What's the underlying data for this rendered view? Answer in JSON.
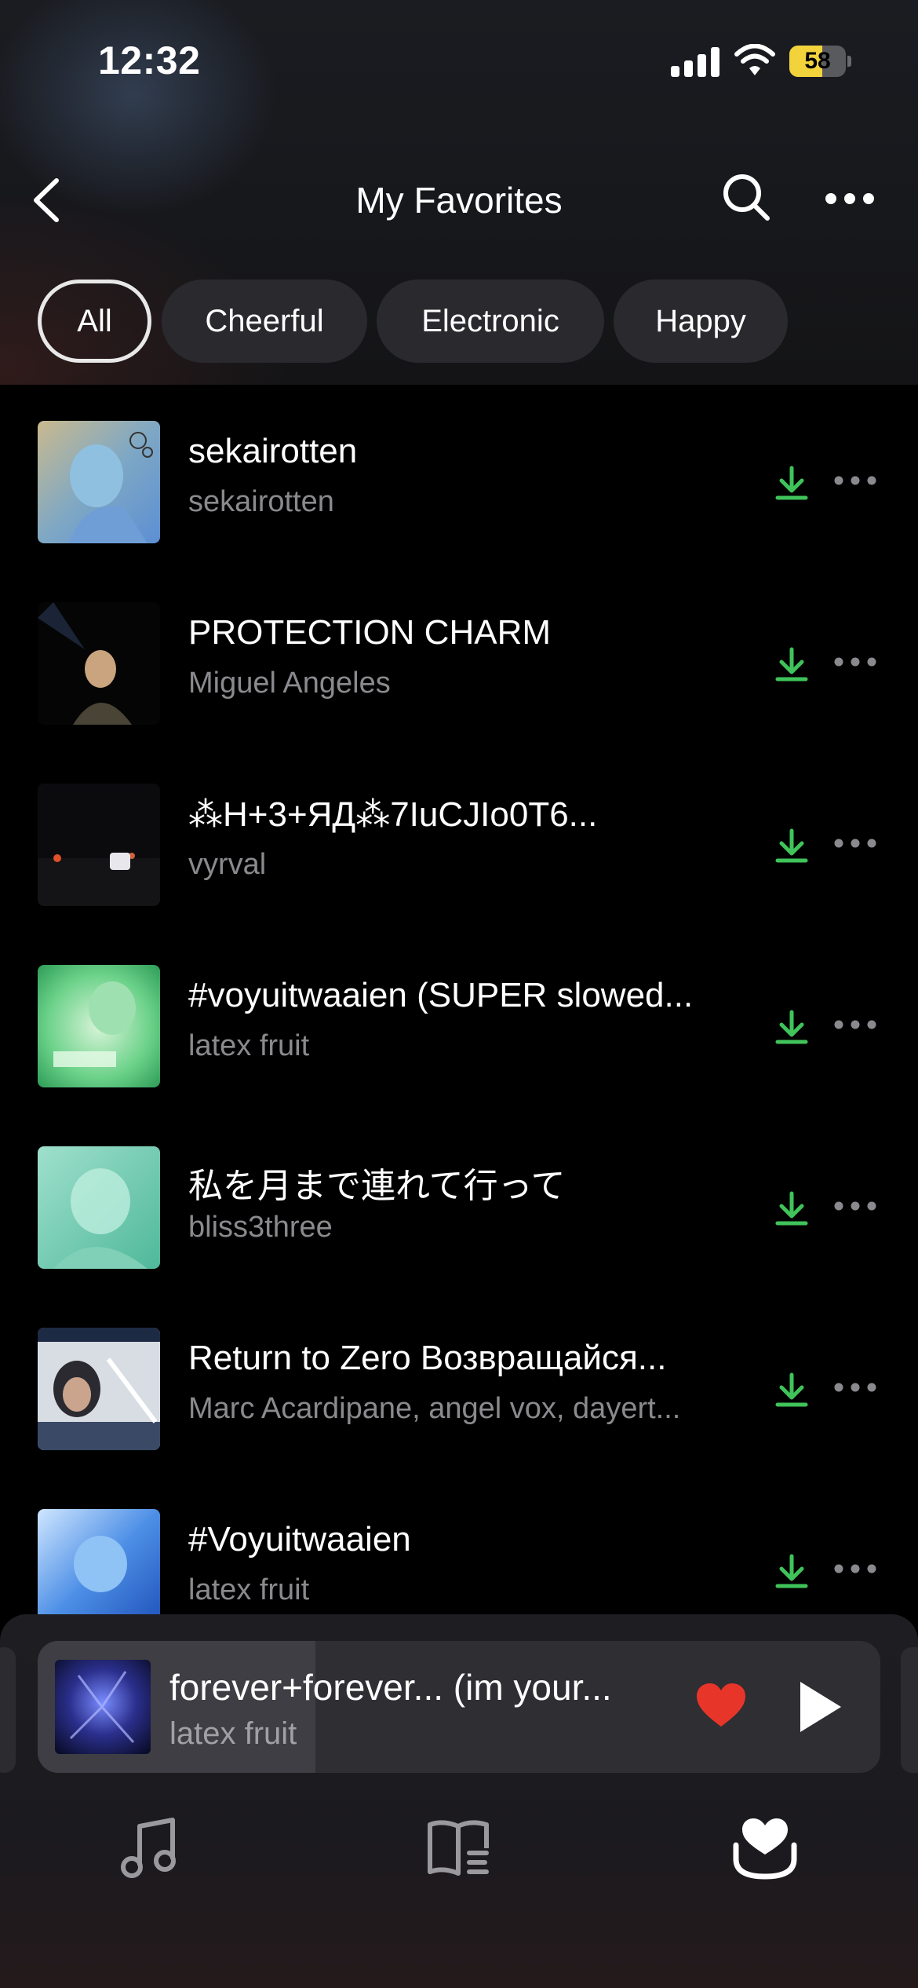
{
  "status_bar": {
    "time": "12:32",
    "battery": "58",
    "battery_level": 0.58
  },
  "header": {
    "title": "My Favorites"
  },
  "filters": [
    {
      "label": "All",
      "active": true
    },
    {
      "label": "Cheerful",
      "active": false
    },
    {
      "label": "Electronic",
      "active": false
    },
    {
      "label": "Happy",
      "active": false
    }
  ],
  "tracks": [
    {
      "title": "sekairotten",
      "artist": "sekairotten"
    },
    {
      "title": "PROTECTION CHARM",
      "artist": "Miguel  Angeles"
    },
    {
      "title": "⁂H+3+ЯД⁂7IuCJIo0T6...",
      "artist": "vyrval"
    },
    {
      "title": "#voyuitwaaien (SUPER slowed...",
      "artist": "latex fruit"
    },
    {
      "title": "私を月まで連れて行って",
      "artist": "bliss3three"
    },
    {
      "title": "Return to Zero Возвращайся...",
      "artist": "Marc Acardipane, angel vox, dayert..."
    },
    {
      "title": "#Voyuitwaaien",
      "artist": "latex fruit"
    }
  ],
  "now_playing": {
    "title": "forever+forever... (im your...",
    "artist": "latex fruit",
    "progress": 0.33
  },
  "colors": {
    "download": "#3fc35a",
    "heart": "#e8352a",
    "battery": "#f2d33b"
  },
  "icons": [
    "back-icon",
    "search-icon",
    "more-icon",
    "download-icon",
    "heart-icon",
    "play-icon",
    "music-note-icon",
    "book-icon",
    "favorites-icon"
  ]
}
